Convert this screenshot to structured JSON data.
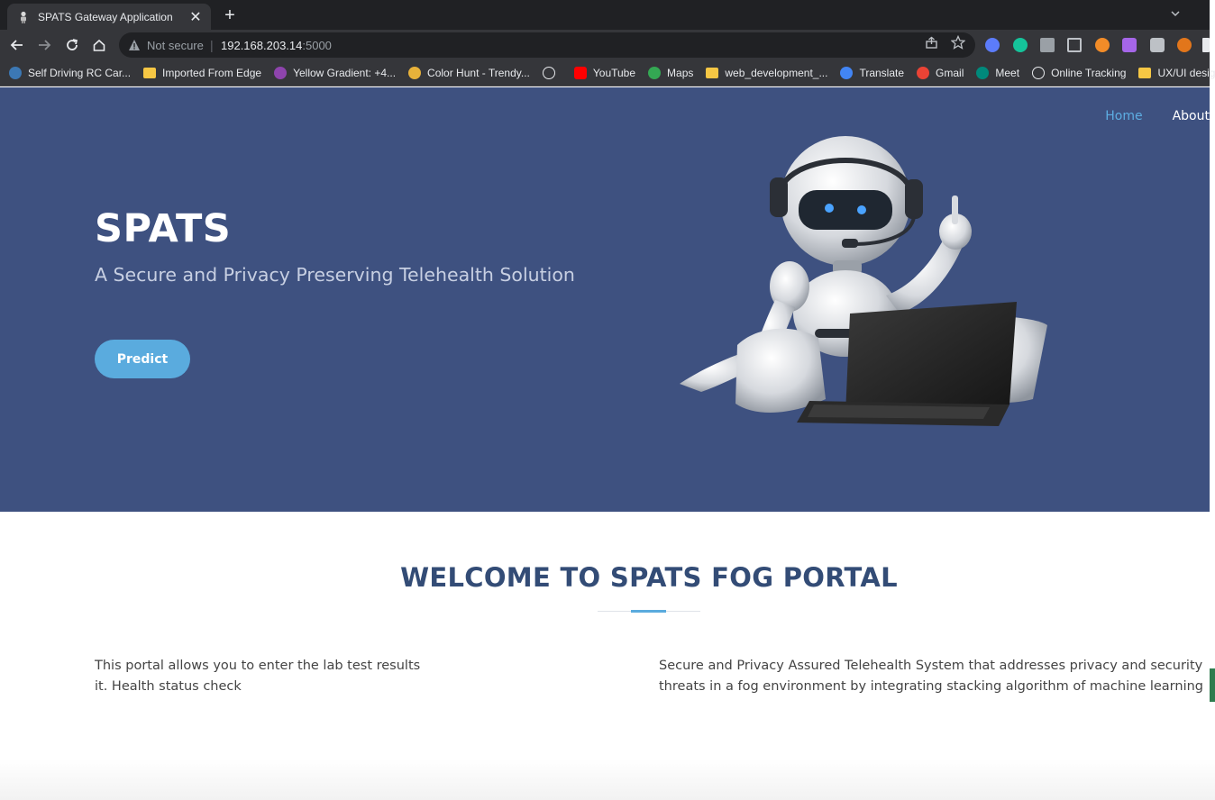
{
  "browser": {
    "tab_title": "SPATS Gateway Application",
    "tab_close": "✕",
    "new_tab": "+",
    "security_label": "Not secure",
    "url_host": "192.168.203.14",
    "url_port": ":5000",
    "bookmarks": [
      {
        "label": "Self Driving RC Car...",
        "icon": "wordpress-icon",
        "color": "#3c78b4"
      },
      {
        "label": "Imported From Edge",
        "icon": "folder-icon",
        "color": "#f6c744"
      },
      {
        "label": "Yellow Gradient: +4...",
        "icon": "gradient-icon",
        "color": "#8e44ad"
      },
      {
        "label": "Color Hunt - Trendy...",
        "icon": "colorhunt-icon",
        "color": "#e8b23a"
      },
      {
        "label": "",
        "icon": "globe-icon",
        "color": "#e8eaed"
      },
      {
        "label": "YouTube",
        "icon": "youtube-icon",
        "color": "#ff0000"
      },
      {
        "label": "Maps",
        "icon": "maps-icon",
        "color": "#34a853"
      },
      {
        "label": "web_development_...",
        "icon": "folder-icon",
        "color": "#f6c744"
      },
      {
        "label": "Translate",
        "icon": "translate-icon",
        "color": "#4285f4"
      },
      {
        "label": "Gmail",
        "icon": "gmail-icon",
        "color": "#ea4335"
      },
      {
        "label": "Meet",
        "icon": "meet-icon",
        "color": "#00897b"
      },
      {
        "label": "Online Tracking",
        "icon": "globe-icon",
        "color": "#e8eaed"
      },
      {
        "label": "UX/UI design",
        "icon": "folder-icon",
        "color": "#f6c744"
      }
    ]
  },
  "nav": {
    "home": "Home",
    "about": "About"
  },
  "hero": {
    "title": "SPATS",
    "subtitle": "A Secure and Privacy Preserving Telehealth Solution",
    "button": "Predict"
  },
  "welcome": {
    "title": "WELCOME TO SPATS FOG PORTAL",
    "left_text": "This portal allows you to enter the lab test results",
    "left_text_2": "it. Health status check",
    "right_text": "Secure and Privacy Assured Telehealth System that addresses privacy and security threats in a fog environment by integrating stacking algorithm of machine learning in"
  },
  "colors": {
    "hero_bg": "#3e5180",
    "accent": "#5aabde",
    "heading": "#334c76"
  }
}
